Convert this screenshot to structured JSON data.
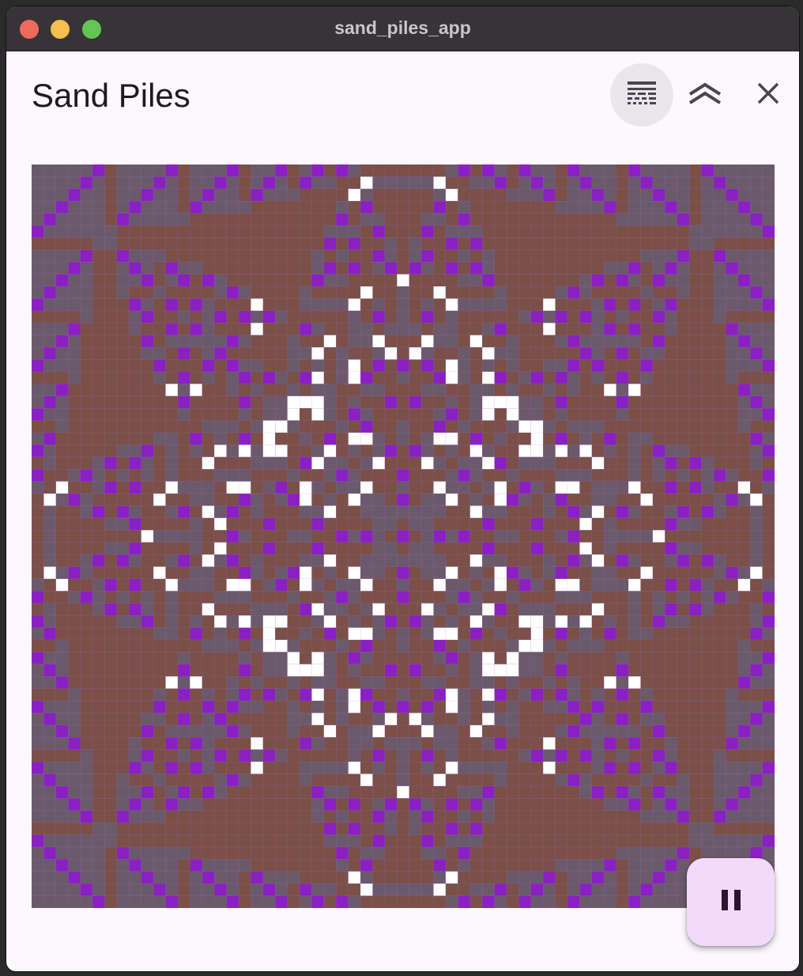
{
  "window": {
    "title": "sand_piles_app"
  },
  "appbar": {
    "title": "Sand Piles",
    "actions": [
      {
        "icon": "grid-view-icon",
        "selected": true
      },
      {
        "icon": "double-chevron-up-icon",
        "selected": false
      },
      {
        "icon": "close-icon",
        "selected": false
      }
    ]
  },
  "sandpile": {
    "size": 61,
    "colors": {
      "0": "#8a20c2",
      "1": "#ffffff",
      "2": "#6b5a6b",
      "3": "#7a5048",
      "grid": "#b98ad8"
    }
  },
  "fab": {
    "icon": "pause-icon"
  }
}
